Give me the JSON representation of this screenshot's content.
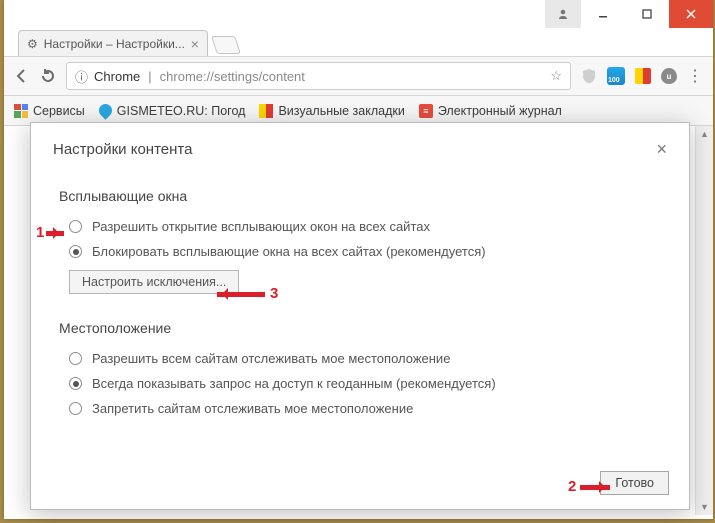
{
  "window": {
    "tab_title": "Настройки – Настройки...",
    "controls": {
      "user": "user-icon",
      "min": "minimize",
      "max": "maximize",
      "close": "close"
    }
  },
  "toolbar": {
    "chrome_label": "Chrome",
    "url": "chrome://settings/content"
  },
  "bookmarks": {
    "apps": "Сервисы",
    "gismeteo": "GISMETEO.RU: Погод",
    "visual": "Визуальные закладки",
    "journal": "Электронный журнал"
  },
  "dialog": {
    "title": "Настройки контента",
    "popups": {
      "section": "Всплывающие окна",
      "allow": "Разрешить открытие всплывающих окон на всех сайтах",
      "block": "Блокировать всплывающие окна на всех сайтах (рекомендуется)",
      "exceptions": "Настроить исключения..."
    },
    "location": {
      "section": "Местоположение",
      "allow": "Разрешить всем сайтам отслеживать мое местоположение",
      "ask": "Всегда показывать запрос на доступ к геоданным (рекомендуется)",
      "deny": "Запретить сайтам отслеживать мое местоположение"
    },
    "done": "Готово"
  },
  "annotations": {
    "a1": "1",
    "a2": "2",
    "a3": "3"
  }
}
